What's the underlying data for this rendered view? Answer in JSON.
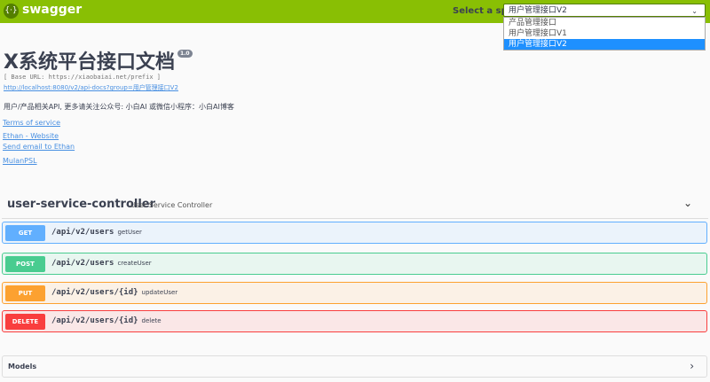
{
  "header": {
    "logo_icon": "swagger-logo",
    "brand": "swagger",
    "spec_label": "Select a spec",
    "selected_spec": "用户管理接口V2",
    "spec_options": [
      "产品管理接口",
      "用户管理接口V1",
      "用户管理接口V2"
    ]
  },
  "info": {
    "title": "X系统平台接口文档",
    "version": "1.0",
    "base_url": "[ Base URL: https://xiaobaiai.net/prefix ]",
    "spec_url": "http://localhost:8080/v2/api-docs?group=用户管理接口V2",
    "description": "用户/产品相关API, 更多请关注公众号: 小白AI 或微信小程序：小白AI博客",
    "links": [
      "Terms of service",
      "Ethan - Website",
      "Send email to Ethan",
      "MulanPSL"
    ]
  },
  "controller": {
    "name": "user-service-controller",
    "description": "User Service Controller",
    "operations": [
      {
        "method": "GET",
        "path": "/api/v2/users",
        "summary": "getUser",
        "color": "#61affe",
        "bg": "#ebf3fb"
      },
      {
        "method": "POST",
        "path": "/api/v2/users",
        "summary": "createUser",
        "color": "#49cc90",
        "bg": "#e8f6f0"
      },
      {
        "method": "PUT",
        "path": "/api/v2/users/{id}",
        "summary": "updateUser",
        "color": "#fca130",
        "bg": "#fbf1e6"
      },
      {
        "method": "DELETE",
        "path": "/api/v2/users/{id}",
        "summary": "delete",
        "color": "#f93e3e",
        "bg": "#fae7e7"
      }
    ]
  },
  "models": {
    "label": "Models"
  }
}
